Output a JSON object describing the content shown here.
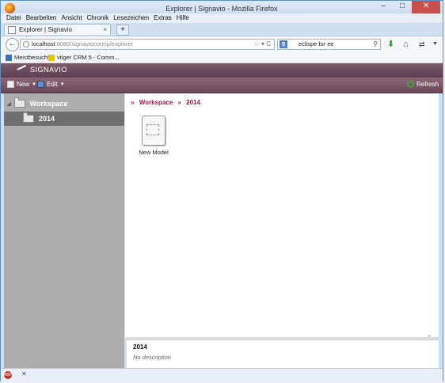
{
  "window": {
    "title": "Explorer | Signavio - Mozilla Firefox",
    "buttons": [
      "–",
      "□",
      "✕"
    ]
  },
  "menu": [
    "Datei",
    "Bearbeiten",
    "Ansicht",
    "Chronik",
    "Lesezeichen",
    "Extras",
    "Hilfe"
  ],
  "tab": {
    "title": "Explorer | Signavio",
    "close": "×",
    "new_tab": "+"
  },
  "url": {
    "host": "localhost",
    "path": ":8080/signaviocore/p/explorer",
    "icons": "☆ ▾ C"
  },
  "search": {
    "engine_icon": "g",
    "value": "eclispe for ee",
    "icon": "🔍"
  },
  "bookmarks": [
    {
      "label": "Meistbesucht",
      "icon": "blue-book-icon"
    },
    {
      "label": "vtiger CRM 5 - Comm...",
      "icon": "tiger-icon"
    }
  ],
  "app": {
    "brand": "SIGNAVIO",
    "toolbar": {
      "new_label": "New",
      "edit_label": "Edit",
      "refresh_label": "Refresh"
    }
  },
  "sidebar": {
    "items": [
      {
        "label": "Workspace"
      },
      {
        "label": "2014"
      }
    ]
  },
  "breadcrumb": [
    "Workspace",
    "2014"
  ],
  "breadcrumb_sep": "»",
  "models": [
    {
      "label": "New Model"
    }
  ],
  "details": {
    "title": "2014",
    "description": "No description"
  },
  "colors": {
    "accent": "#9b1d52",
    "header": "#6a4658",
    "sidebar": "#adadad"
  }
}
